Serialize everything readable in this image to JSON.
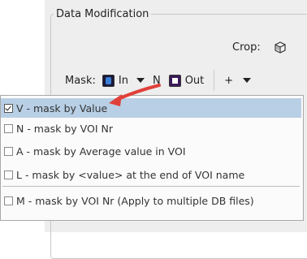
{
  "group": {
    "title": "Data Modification"
  },
  "crop": {
    "label": "Crop:",
    "icon": "crop-cube-icon"
  },
  "mask_toolbar": {
    "mask_label": "Mask:",
    "in_label": "In",
    "n_label": "N",
    "out_label": "Out",
    "plus_label": "+"
  },
  "menu": {
    "items": [
      {
        "label": "V - mask by Value",
        "checked": true
      },
      {
        "label": "N - mask by VOI Nr",
        "checked": false
      },
      {
        "label": "A - mask by Average value in VOI",
        "checked": false
      },
      {
        "label": "L - mask by <value> at the end of VOI name",
        "checked": false
      },
      {
        "label": "M - mask by VOI Nr (Apply to multiple DB files)",
        "checked": false
      }
    ]
  },
  "colors": {
    "selection": "#b8cfe5",
    "arrow": "#e0403a"
  }
}
